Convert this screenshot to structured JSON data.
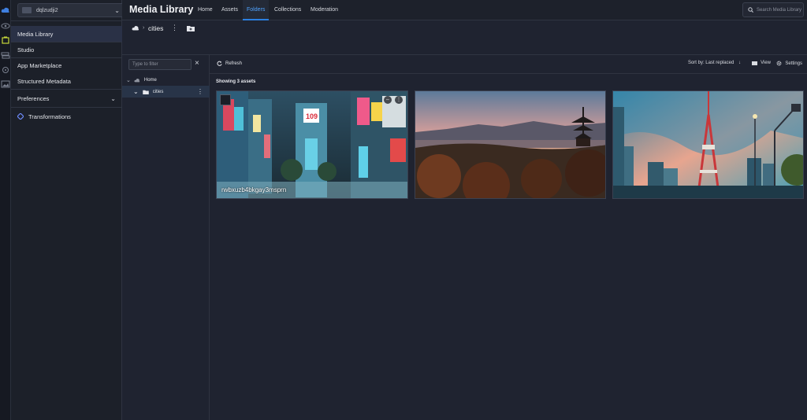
{
  "environment": {
    "name": "dqlzudji2"
  },
  "sidebar": {
    "items": [
      {
        "label": "Media Library"
      },
      {
        "label": "Studio"
      },
      {
        "label": "App Marketplace"
      },
      {
        "label": "Structured Metadata"
      },
      {
        "label": "Preferences"
      },
      {
        "label": "Transformations"
      }
    ]
  },
  "topnav": {
    "title": "Media Library",
    "tabs": [
      {
        "label": "Home"
      },
      {
        "label": "Assets"
      },
      {
        "label": "Folders"
      },
      {
        "label": "Collections"
      },
      {
        "label": "Moderation"
      }
    ],
    "search_placeholder": "Search Media Library"
  },
  "breadcrumb": {
    "current": "cities"
  },
  "tree": {
    "filter_placeholder": "Type to filter",
    "nodes": [
      {
        "label": "Home"
      },
      {
        "label": "cities"
      }
    ]
  },
  "toolbar": {
    "refresh": "Refresh",
    "sort": "Sort by: Last replaced",
    "view": "View",
    "settings": "Settings"
  },
  "assets": {
    "summary": "Showing 3 assets",
    "items": [
      {
        "caption": "rwbxuzb4bkgay3msprn"
      },
      {
        "caption": ""
      },
      {
        "caption": ""
      }
    ]
  },
  "colors": {
    "accent": "#2b7fe0",
    "active_tab": "#4fa3ff",
    "background": "#1f2330"
  }
}
